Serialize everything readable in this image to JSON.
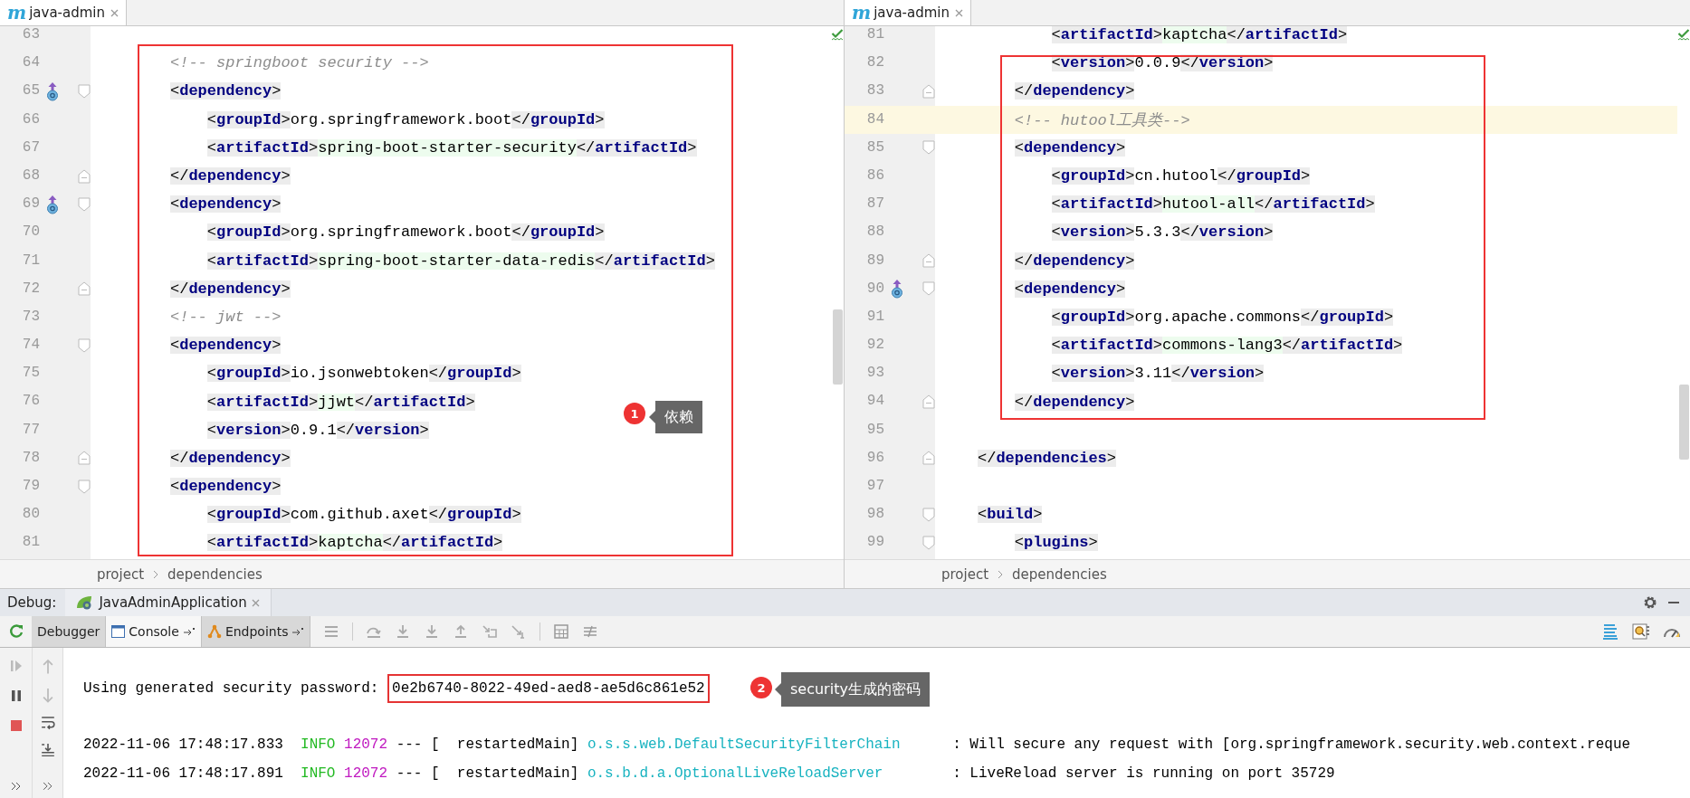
{
  "editors": [
    {
      "tab": {
        "icon_letter": "m",
        "label": "java-admin"
      },
      "breadcrumb": [
        "project",
        "dependencies"
      ],
      "lines": [
        {
          "number": "63",
          "marker": false,
          "current": false
        },
        {
          "number": "64",
          "parts": [
            {
              "kind": "comment",
              "text": "<!-- springboot security -->"
            }
          ],
          "marker": false,
          "current": false
        },
        {
          "number": "65",
          "parts": [
            {
              "kind": "tag",
              "text": "<dependency>"
            }
          ],
          "marker": true,
          "kind": "fold-start",
          "current": false
        },
        {
          "number": "66",
          "parts": [
            {
              "kind": "tag",
              "text": "<groupId>"
            },
            {
              "kind": "text",
              "text": "org.springframework.boot"
            },
            {
              "kind": "tag",
              "text": "</groupId>"
            }
          ],
          "marker": false,
          "current": false
        },
        {
          "number": "67",
          "parts": [
            {
              "kind": "tag",
              "text": "<artifactId>"
            },
            {
              "kind": "hl",
              "text": "spring-boot-starter-security"
            },
            {
              "kind": "tag",
              "text": "</artifactId>"
            }
          ],
          "marker": false,
          "current": false
        },
        {
          "number": "68",
          "parts": [
            {
              "kind": "tag",
              "text": "</dependency>"
            }
          ],
          "marker": false,
          "kind": "fold-end",
          "current": false
        },
        {
          "number": "69",
          "parts": [
            {
              "kind": "tag",
              "text": "<dependency>"
            }
          ],
          "marker": true,
          "kind": "fold-start",
          "current": false
        },
        {
          "number": "70",
          "parts": [
            {
              "kind": "tag",
              "text": "<groupId>"
            },
            {
              "kind": "text",
              "text": "org.springframework.boot"
            },
            {
              "kind": "tag",
              "text": "</groupId>"
            }
          ],
          "marker": false,
          "current": false
        },
        {
          "number": "71",
          "parts": [
            {
              "kind": "tag",
              "text": "<artifactId>"
            },
            {
              "kind": "hl",
              "text": "spring-boot-starter-data-redis"
            },
            {
              "kind": "tag",
              "text": "</artifactId>"
            }
          ],
          "marker": false,
          "current": false
        },
        {
          "number": "72",
          "parts": [
            {
              "kind": "tag",
              "text": "</dependency>"
            }
          ],
          "marker": false,
          "kind": "fold-end",
          "current": false
        },
        {
          "number": "73",
          "parts": [
            {
              "kind": "comment",
              "text": "<!-- jwt -->"
            }
          ],
          "marker": false,
          "current": false
        },
        {
          "number": "74",
          "parts": [
            {
              "kind": "tag",
              "text": "<dependency>"
            }
          ],
          "marker": false,
          "kind": "fold-start",
          "current": false
        },
        {
          "number": "75",
          "parts": [
            {
              "kind": "tag",
              "text": "<groupId>"
            },
            {
              "kind": "text",
              "text": "io.jsonwebtoken"
            },
            {
              "kind": "tag",
              "text": "</groupId>"
            }
          ],
          "marker": false,
          "current": false
        },
        {
          "number": "76",
          "parts": [
            {
              "kind": "tag",
              "text": "<artifactId>"
            },
            {
              "kind": "hl",
              "text": "jjwt"
            },
            {
              "kind": "tag",
              "text": "</artifactId>"
            }
          ],
          "marker": false,
          "current": false
        },
        {
          "number": "77",
          "parts": [
            {
              "kind": "tag",
              "text": "<version>"
            },
            {
              "kind": "text",
              "text": "0.9.1"
            },
            {
              "kind": "tag",
              "text": "</version>"
            }
          ],
          "marker": false,
          "current": false
        },
        {
          "number": "78",
          "parts": [
            {
              "kind": "tag",
              "text": "</dependency>"
            }
          ],
          "marker": false,
          "kind": "fold-end",
          "current": false
        },
        {
          "number": "79",
          "parts": [
            {
              "kind": "tag",
              "text": "<dependency>"
            }
          ],
          "marker": false,
          "kind": "fold-start",
          "current": false
        },
        {
          "number": "80",
          "parts": [
            {
              "kind": "tag",
              "text": "<groupId>"
            },
            {
              "kind": "text",
              "text": "com.github.axet"
            },
            {
              "kind": "tag",
              "text": "</groupId>"
            }
          ],
          "marker": false,
          "current": false
        },
        {
          "number": "81",
          "parts": [
            {
              "kind": "tag",
              "text": "<artifactId>"
            },
            {
              "kind": "hl",
              "text": "kaptcha"
            },
            {
              "kind": "tag",
              "text": "</artifactId>"
            }
          ],
          "marker": false,
          "current": false
        }
      ]
    },
    {
      "tab": {
        "icon_letter": "m",
        "label": "java-admin"
      },
      "breadcrumb": [
        "project",
        "dependencies"
      ],
      "lines": [
        {
          "number": "81",
          "parts": [
            {
              "kind": "tag",
              "text": "<artifactId>"
            },
            {
              "kind": "hl",
              "text": "kaptcha"
            },
            {
              "kind": "tag",
              "text": "</artifactId>"
            }
          ],
          "marker": false,
          "current": false
        },
        {
          "number": "82",
          "parts": [
            {
              "kind": "tag",
              "text": "<version>"
            },
            {
              "kind": "text",
              "text": "0.0.9"
            },
            {
              "kind": "tag",
              "text": "</version>"
            }
          ],
          "marker": false,
          "current": false
        },
        {
          "number": "83",
          "parts": [
            {
              "kind": "tag",
              "text": "</dependency>"
            }
          ],
          "marker": false,
          "kind": "fold-end",
          "current": false
        },
        {
          "number": "84",
          "parts": [
            {
              "kind": "comment",
              "text": "<!-- hutool工具类-->"
            }
          ],
          "marker": false,
          "current": true
        },
        {
          "number": "85",
          "parts": [
            {
              "kind": "tag",
              "text": "<dependency>"
            }
          ],
          "marker": false,
          "kind": "fold-start",
          "current": false
        },
        {
          "number": "86",
          "parts": [
            {
              "kind": "tag",
              "text": "<groupId>"
            },
            {
              "kind": "text",
              "text": "cn.hutool"
            },
            {
              "kind": "tag",
              "text": "</groupId>"
            }
          ],
          "marker": false,
          "current": false
        },
        {
          "number": "87",
          "parts": [
            {
              "kind": "tag",
              "text": "<artifactId>"
            },
            {
              "kind": "hl",
              "text": "hutool-all"
            },
            {
              "kind": "tag",
              "text": "</artifactId>"
            }
          ],
          "marker": false,
          "current": false
        },
        {
          "number": "88",
          "parts": [
            {
              "kind": "tag",
              "text": "<version>"
            },
            {
              "kind": "text",
              "text": "5.3.3"
            },
            {
              "kind": "tag",
              "text": "</version>"
            }
          ],
          "marker": false,
          "current": false
        },
        {
          "number": "89",
          "parts": [
            {
              "kind": "tag",
              "text": "</dependency>"
            }
          ],
          "marker": false,
          "kind": "fold-end",
          "current": false
        },
        {
          "number": "90",
          "parts": [
            {
              "kind": "tag",
              "text": "<dependency>"
            }
          ],
          "marker": true,
          "kind": "fold-start",
          "current": false
        },
        {
          "number": "91",
          "parts": [
            {
              "kind": "tag",
              "text": "<groupId>"
            },
            {
              "kind": "text",
              "text": "org.apache.commons"
            },
            {
              "kind": "tag",
              "text": "</groupId>"
            }
          ],
          "marker": false,
          "current": false
        },
        {
          "number": "92",
          "parts": [
            {
              "kind": "tag",
              "text": "<artifactId>"
            },
            {
              "kind": "hl",
              "text": "commons-lang3"
            },
            {
              "kind": "tag",
              "text": "</artifactId>"
            }
          ],
          "marker": false,
          "current": false
        },
        {
          "number": "93",
          "parts": [
            {
              "kind": "tag",
              "text": "<version>"
            },
            {
              "kind": "text",
              "text": "3.11"
            },
            {
              "kind": "tag",
              "text": "</version>"
            }
          ],
          "marker": false,
          "current": false
        },
        {
          "number": "94",
          "parts": [
            {
              "kind": "tag",
              "text": "</dependency>"
            }
          ],
          "marker": false,
          "kind": "fold-end",
          "current": false
        },
        {
          "number": "95",
          "marker": false,
          "current": false
        },
        {
          "number": "96",
          "parts": [
            {
              "kind": "tag",
              "text": "</dependencies>"
            }
          ],
          "marker": false,
          "kind": "fold-end",
          "current": false
        },
        {
          "number": "97",
          "marker": false,
          "current": false
        },
        {
          "number": "98",
          "parts": [
            {
              "kind": "tag",
              "text": "<build>"
            }
          ],
          "marker": false,
          "kind": "fold-start",
          "current": false
        },
        {
          "number": "99",
          "parts": [
            {
              "kind": "tag",
              "text": "<plugins>"
            }
          ],
          "marker": false,
          "kind": "fold-start",
          "current": false
        }
      ]
    }
  ],
  "debug": {
    "label": "Debug:",
    "session_tab": "JavaAdminApplication",
    "tabs": [
      {
        "label": "Debugger",
        "selected": false
      },
      {
        "label": "Console",
        "selected": true,
        "kind": "console"
      },
      {
        "label": "Endpoints",
        "selected": false,
        "kind": "endpoints"
      }
    ]
  },
  "console": {
    "password_label": "Using generated security password:",
    "password": "0e2b6740-8022-49ed-aed8-ae5d6c861e52",
    "logs": [
      {
        "time": "2022-11-06 17:48:17.833",
        "severity": "INFO",
        "pid": "12072",
        "thread": "--- [  restartedMain]",
        "logger": "o.s.s.web.DefaultSecurityFilterChain",
        "message": ": Will secure any request with [org.springframework.security.web.context.reque"
      },
      {
        "time": "2022-11-06 17:48:17.891",
        "severity": "INFO",
        "pid": "12072",
        "thread": "--- [  restartedMain]",
        "logger": "o.s.b.d.a.OptionalLiveReloadServer",
        "message": ": LiveReload server is running on port 35729"
      }
    ]
  },
  "callouts": [
    {
      "number": "1",
      "text": "依赖"
    },
    {
      "number": "2",
      "text": "security生成的密码"
    }
  ]
}
